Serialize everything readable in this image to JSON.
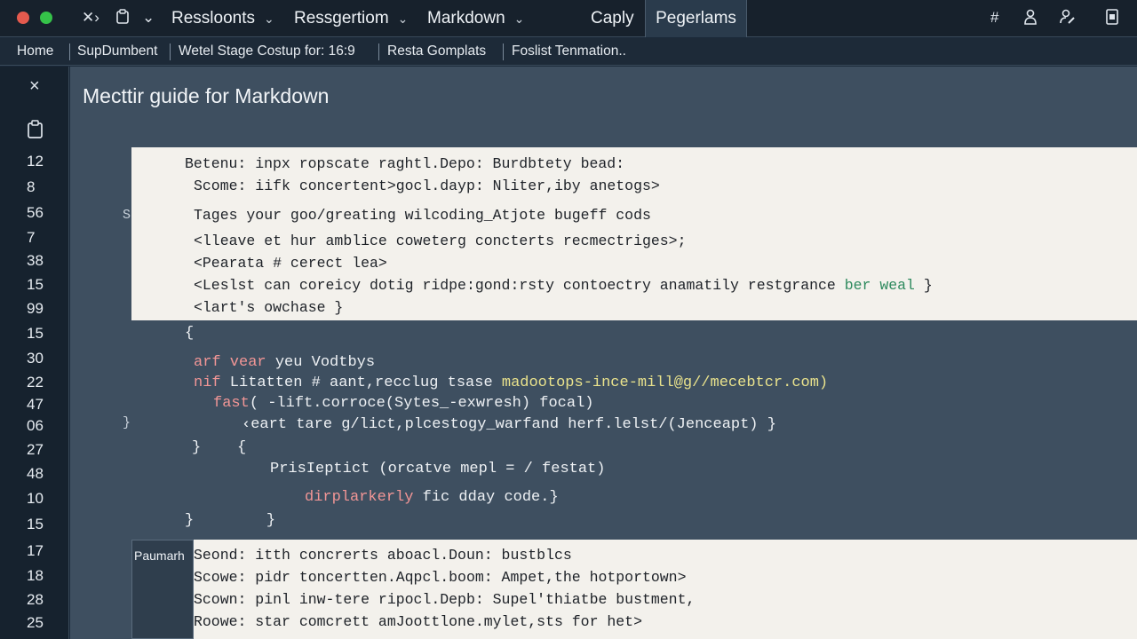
{
  "titlebar": {
    "menus": [
      {
        "label": "Ressloonts"
      },
      {
        "label": "Ressgertiom"
      },
      {
        "label": "Markdown"
      }
    ],
    "copy_label": "Caply",
    "active_tab_label": "Pegerlams",
    "left_icons": [
      "close-collapse-icon",
      "clipboard-icon",
      "chevron-down-icon"
    ],
    "right_icons": [
      "hash-icon",
      "person-icon",
      "user-edit-icon",
      "document-icon"
    ]
  },
  "tabs": [
    {
      "label": "Home"
    },
    {
      "label": "SupDumbent"
    },
    {
      "label": "Wetel Stage Costup for: 16:9"
    },
    {
      "label": "Resta Gomplats"
    },
    {
      "label": "Foslist Tenmation.."
    }
  ],
  "sidebar": {
    "close_icon": "close-icon",
    "doc_icon": "clipboard-icon",
    "line_numbers": [
      "12",
      "8",
      "56",
      "7",
      "38",
      "15",
      "99",
      "15",
      "30",
      "22",
      "47",
      "06",
      "27",
      "48",
      "10",
      "15",
      "17",
      "18",
      "28",
      "25"
    ]
  },
  "document": {
    "title": "Mecttir guide for Markdown",
    "gutter_marks": [
      "S",
      "}"
    ],
    "panel_top_lines": [
      "Betenu: inpx ropscate raghtl.Depo: Burdbtety bead:",
      "Scome: iifk concertent>gocl.dayp: Nliter,iby anetogs>",
      "Tages your goo/greating wilcoding_Atjote bugeff cods",
      "<lleave et hur amblice coweterg concterts recmectriges>;",
      "<Pearata # cerect lea>",
      "<Leslst can coreicy dotig ridpe:gond:rsty contoectry anamatily restgrance",
      "<lart's owchase }"
    ],
    "panel_top_green": "ber weal",
    "panel_top_green_tail": " }",
    "code": {
      "l1": "{",
      "l2_kw": "arf vear",
      "l2_rest": " yeu Vodtbys",
      "l3_kw": "nif",
      "l3_rest": " Litatten # aant,recclug tsase ",
      "l3_str": "madootops-ince-mill@g//mecebtcr.com)",
      "l4_kw": "fast",
      "l4_rest": "( -lift.corroce(Sytes_-exwresh) focal)",
      "l5": "‹eart tare g/lict,plcestogy_warfand herf.lelst/(Jenceapt) }",
      "l6": "}    {",
      "l7": "PrisIeptict (orcatve mepl = / festat)",
      "l8_kw": "dirplarkerly",
      "l8_rest": " fic dday code.}",
      "l9": "}        }"
    },
    "label_box": "Paumarh",
    "panel_bottom_lines": [
      "Seond: itth concrerts aboacl.Doun: bustblcs",
      "Scowe: pidr toncertten.Aqpcl.boom: Ampet,the hotportown>",
      "Scown: pinl inw-tere ripocl.Depb: Supel'thiatbe bustment,",
      "Roowe: star comcrett amJoottlone.mylet,sts for het>"
    ]
  },
  "colors": {
    "titlebar_bg": "#17212c",
    "editor_bg": "#3e4f60",
    "panel_light_bg": "#f3f1ec",
    "keyword": "#f29696",
    "string": "#e9e28c",
    "green_text": "#2e8a5e"
  }
}
